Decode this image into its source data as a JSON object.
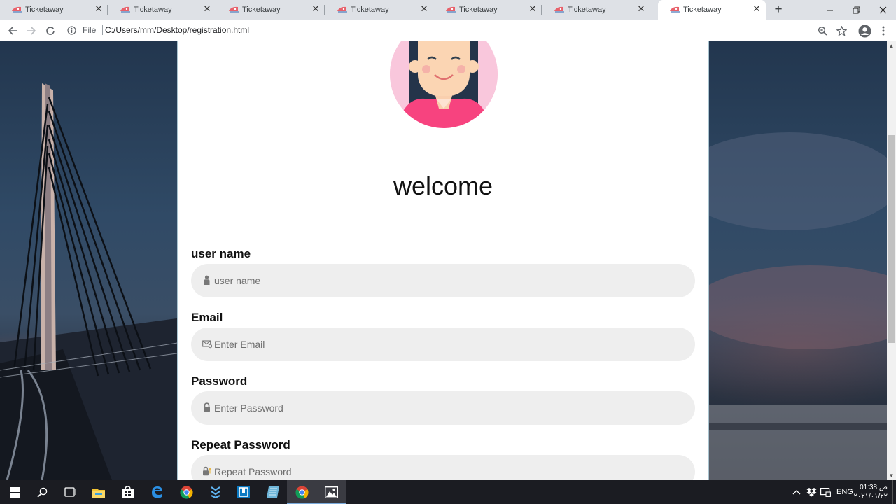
{
  "browser": {
    "tabs": [
      {
        "title": "Ticketaway",
        "active": false
      },
      {
        "title": "Ticketaway",
        "active": false
      },
      {
        "title": "Ticketaway",
        "active": false
      },
      {
        "title": "Ticketaway",
        "active": false
      },
      {
        "title": "Ticketaway",
        "active": false
      },
      {
        "title": "Ticketaway",
        "active": false
      },
      {
        "title": "Ticketaway",
        "active": true
      }
    ],
    "new_tab_icon": "plus-icon",
    "address_scheme": "File",
    "address_url": "C:/Users/mm/Desktop/registration.html"
  },
  "page": {
    "welcome": "welcome",
    "fields": [
      {
        "label": "user name",
        "placeholder": "user name",
        "icon": "user-icon"
      },
      {
        "label": "Email",
        "placeholder": "Enter Email",
        "icon": "envelope-icon"
      },
      {
        "label": "Password",
        "placeholder": "Enter Password",
        "icon": "lock-icon"
      },
      {
        "label": "Repeat Password",
        "placeholder": "Repeat Password",
        "icon": "lock-key-icon"
      }
    ]
  },
  "taskbar": {
    "apps": [
      "start-icon",
      "search-icon",
      "task-view-icon",
      "file-explorer-icon",
      "store-icon",
      "edge-icon",
      "chrome-icon",
      "app-icon",
      "app-icon",
      "notepad-icon",
      "chrome-icon",
      "photos-icon"
    ],
    "language": "ENG",
    "time": "01:38 ص",
    "date": "٢٠٢١/٠١/٢٢"
  },
  "colors": {
    "accent_pink": "#fc3f80",
    "card_background": "#ffffff",
    "field_background": "#eeeeee"
  }
}
